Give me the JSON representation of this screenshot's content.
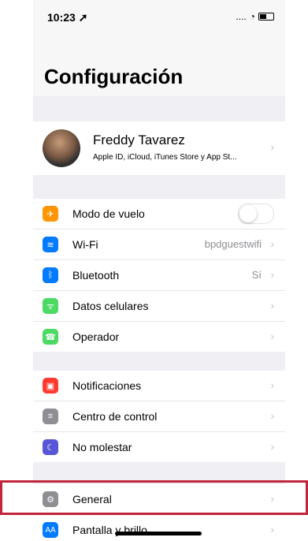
{
  "status": {
    "time": "10:23",
    "signal": "....",
    "wifi": "wifi-icon",
    "battery": "battery-icon",
    "location": "location-arrow-icon"
  },
  "header": {
    "title": "Configuración"
  },
  "profile": {
    "name": "Freddy Tavarez",
    "subtitle": "Apple ID, iCloud, iTunes Store y App St..."
  },
  "groups": [
    {
      "rows": [
        {
          "icon": "airplane-icon",
          "label": "Modo de vuelo",
          "value": "",
          "toggle": false,
          "color": "#ff9500"
        },
        {
          "icon": "wifi-icon",
          "label": "Wi-Fi",
          "value": "bpdguestwifi",
          "color": "#007aff"
        },
        {
          "icon": "bluetooth-icon",
          "label": "Bluetooth",
          "value": "Sí",
          "color": "#007aff"
        },
        {
          "icon": "cellular-icon",
          "label": "Datos celulares",
          "value": "",
          "color": "#4cd964"
        },
        {
          "icon": "phone-icon",
          "label": "Operador",
          "value": "",
          "color": "#4cd964"
        }
      ]
    },
    {
      "rows": [
        {
          "icon": "notifications-icon",
          "label": "Notificaciones",
          "value": "",
          "color": "#ff3b30"
        },
        {
          "icon": "control-center-icon",
          "label": "Centro de control",
          "value": "",
          "color": "#8e8e93"
        },
        {
          "icon": "moon-icon",
          "label": "No molestar",
          "value": "",
          "color": "#5856d6"
        }
      ]
    },
    {
      "rows": [
        {
          "icon": "gear-icon",
          "label": "General",
          "value": "",
          "color": "#8e8e93"
        },
        {
          "icon": "display-brightness-icon",
          "label": "Pantalla y brillo",
          "value": "",
          "color": "#007aff"
        }
      ]
    }
  ]
}
